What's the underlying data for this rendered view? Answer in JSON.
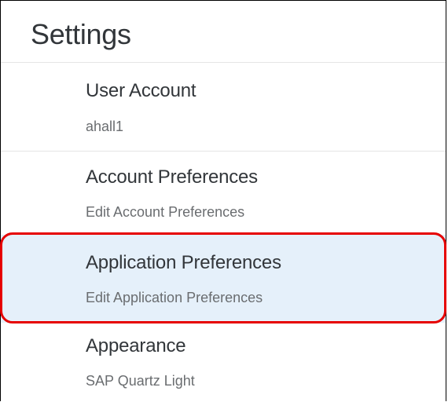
{
  "settings": {
    "title": "Settings",
    "items": [
      {
        "label": "User Account",
        "sub": "ahall1"
      },
      {
        "label": "Account Preferences",
        "sub": "Edit Account Preferences"
      },
      {
        "label": "Application Preferences",
        "sub": "Edit Application Preferences",
        "selected": true
      },
      {
        "label": "Appearance",
        "sub": "SAP Quartz Light"
      }
    ]
  },
  "colors": {
    "selected_bg": "#e5f0fa",
    "highlight_ring": "#e60000",
    "primary_text": "#32363a",
    "secondary_text": "#6a6d70"
  }
}
